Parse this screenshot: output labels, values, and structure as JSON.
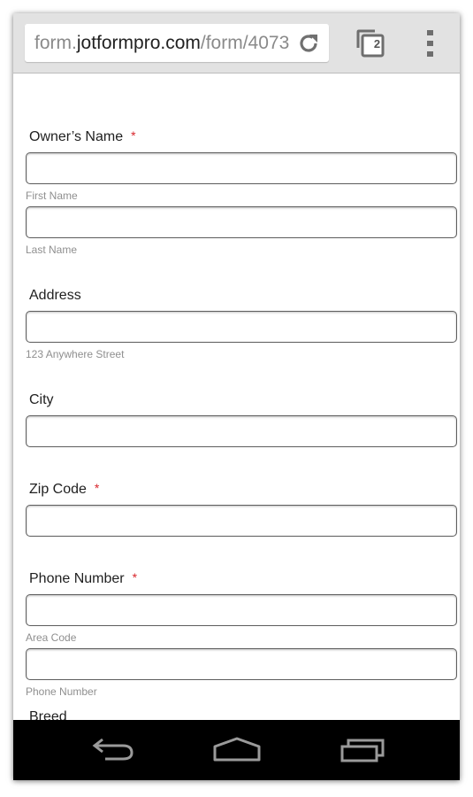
{
  "browser": {
    "url_prefix": "form.",
    "url_domain": "jotformpro.com",
    "url_path": "/form/4073",
    "tab_count": "2"
  },
  "form": {
    "owners_name": {
      "label": "Owner’s Name",
      "required": "*",
      "first_sublabel": "First Name",
      "last_sublabel": "Last Name"
    },
    "address": {
      "label": "Address",
      "sublabel": "123 Anywhere Street"
    },
    "city": {
      "label": "City"
    },
    "zip": {
      "label": "Zip Code",
      "required": "*"
    },
    "phone": {
      "label": "Phone Number",
      "required": "*",
      "area_sublabel": "Area Code",
      "number_sublabel": "Phone Number"
    },
    "partial_next_label": "Breed"
  },
  "colors": {
    "required": "#d8262c",
    "toolbar": "#e2e2e2",
    "navbar": "#000000"
  },
  "icons": [
    "reload-icon",
    "tabs-icon",
    "overflow-menu-icon",
    "back-icon",
    "home-icon",
    "recent-apps-icon"
  ]
}
